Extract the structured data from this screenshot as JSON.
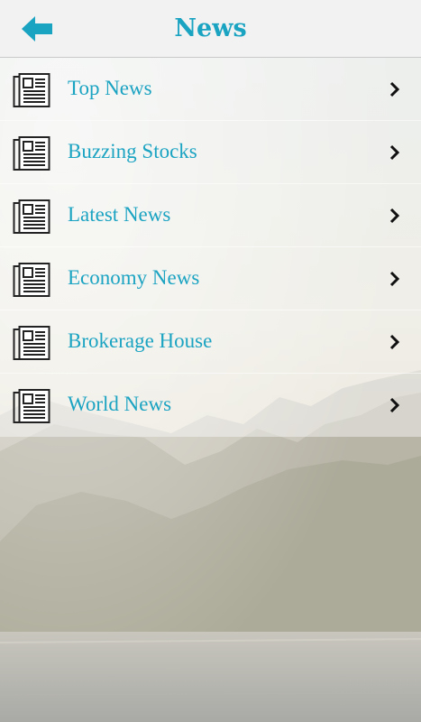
{
  "header": {
    "title": "News",
    "back_icon": "arrow-left-icon",
    "accent_color": "#1ba3c2"
  },
  "menu": {
    "items": [
      {
        "label": "Top News",
        "icon": "newspaper-icon"
      },
      {
        "label": "Buzzing Stocks",
        "icon": "newspaper-icon"
      },
      {
        "label": "Latest News",
        "icon": "newspaper-icon"
      },
      {
        "label": "Economy News",
        "icon": "newspaper-icon"
      },
      {
        "label": "Brokerage House",
        "icon": "newspaper-icon"
      },
      {
        "label": "World News",
        "icon": "newspaper-icon"
      }
    ],
    "chevron_icon": "chevron-right-icon"
  }
}
